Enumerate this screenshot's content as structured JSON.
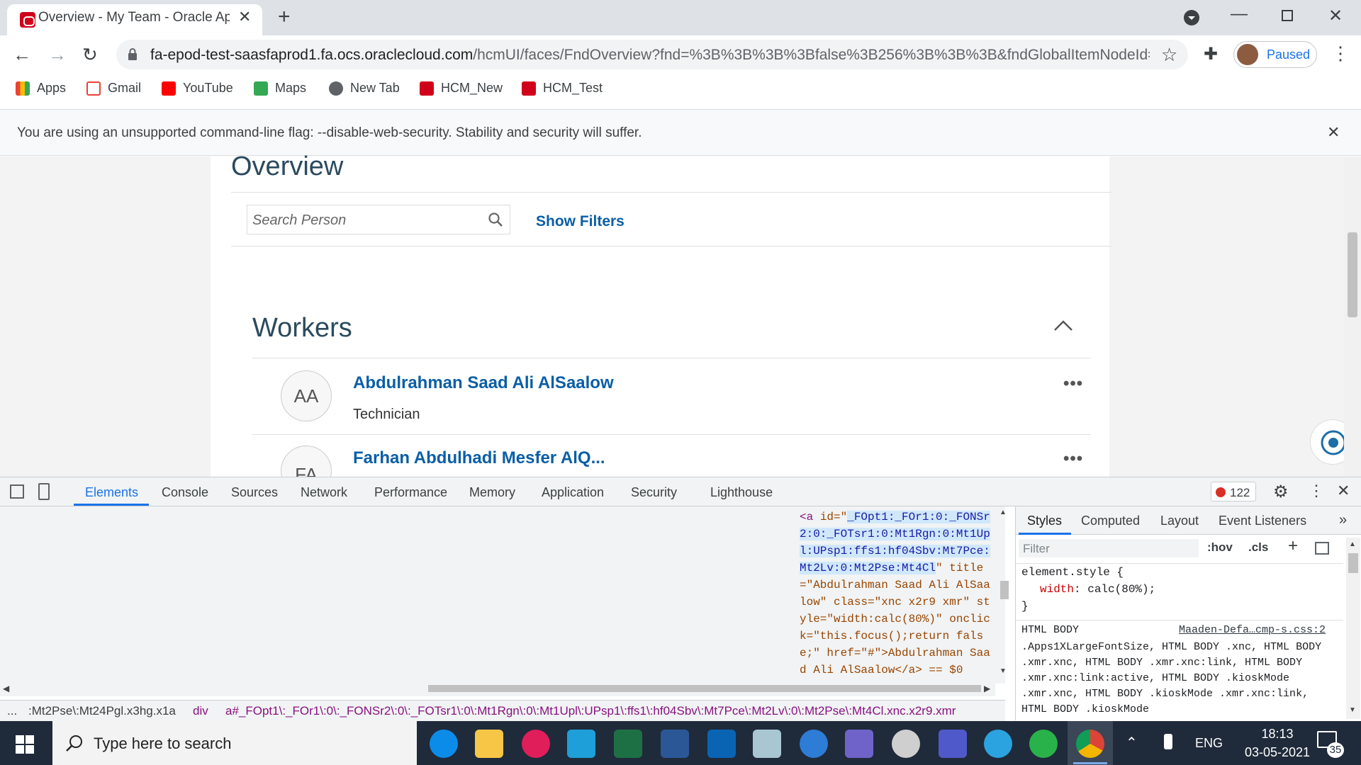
{
  "browser": {
    "tab_title": "Overview - My Team - Oracle Ap",
    "url_host": "fa-epod-test-saasfaprod1.fa.ocs.oraclecloud.com",
    "url_path": "/hcmUI/faces/FndOverview?fnd=%3B%3B%3B%3Bfalse%3B256%3B%3B%3B&fndGlobalItemNodeId=...",
    "profile_label": "Paused",
    "bookmarks": [
      "Apps",
      "Gmail",
      "YouTube",
      "Maps",
      "New Tab",
      "HCM_New",
      "HCM_Test"
    ],
    "infobar_text": "You are using an unsupported command-line flag: --disable-web-security. Stability and security will suffer."
  },
  "page": {
    "title": "Overview",
    "search_placeholder": "Search Person",
    "show_filters": "Show Filters",
    "section_title": "Workers",
    "workers": [
      {
        "initials": "AA",
        "name": "Abdulrahman Saad Ali AlSaalow",
        "role": "Technician"
      },
      {
        "initials": "FA",
        "name": "Farhan Abdulhadi Mesfer AlQ...",
        "role": ""
      }
    ]
  },
  "devtools": {
    "tabs": [
      "Elements",
      "Console",
      "Sources",
      "Network",
      "Performance",
      "Memory",
      "Application",
      "Security",
      "Lighthouse"
    ],
    "error_count": "122",
    "side_tabs": [
      "Styles",
      "Computed",
      "Layout",
      "Event Listeners"
    ],
    "filter_placeholder": "Filter",
    "hov": ":hov",
    "cls": ".cls",
    "element_style_selector": "element.style {",
    "element_style_prop": "width",
    "element_style_val": "calc(80%);",
    "rule_selector": "HTML BODY",
    "rule_source": "Maaden-Defa…cmp-s.css:2",
    "rule_text": ".Apps1XLargeFontSize, HTML BODY .xnc, HTML BODY .xmr.xnc, HTML BODY .xmr.xnc:link, HTML BODY .xmr.xnc:link:active, HTML BODY .kioskMode .xmr.xnc, HTML BODY .kioskMode .xmr.xnc:link, HTML BODY .kioskMode",
    "code_tag": "<a ",
    "code_id_attr": "id=\"",
    "code_id_val": "_FOpt1:_FOr1:0:_FONSr2:0:_FOTsr1:0:Mt1Rgn:0:Mt1Upl:UPsp1:ffs1:hf04Sbv:Mt7Pce:Mt2Lv:0:Mt2Pse:Mt4Cl",
    "code_rest": "\" title=\"Abdulrahman Saad Ali AlSaalow\" class=\"xnc x2r9 xmr\" style=\"width:calc(80%)\" onclick=\"this.focus();return false;\" href=\"#\">Abdulrahman Saad Ali AlSaalow</a> == $0",
    "crumb_1": "...",
    "crumb_2": ":Mt2Pse\\:Mt24Pgl.x3hg.x1a",
    "crumb_3": "div",
    "crumb_4": "a#_FOpt1\\:_FOr1\\:0\\:_FONSr2\\:0\\:_FOTsr1\\:0\\:Mt1Rgn\\:0\\:Mt1Upl\\:UPsp1\\:ffs1\\:hf04Sbv\\:Mt7Pce\\:Mt2Lv\\:0\\:Mt2Pse\\:Mt4Cl.xnc.x2r9.xmr"
  },
  "taskbar": {
    "search_placeholder": "Type here to search",
    "lang": "ENG",
    "time": "18:13",
    "date": "03-05-2021",
    "notifications": "35"
  }
}
